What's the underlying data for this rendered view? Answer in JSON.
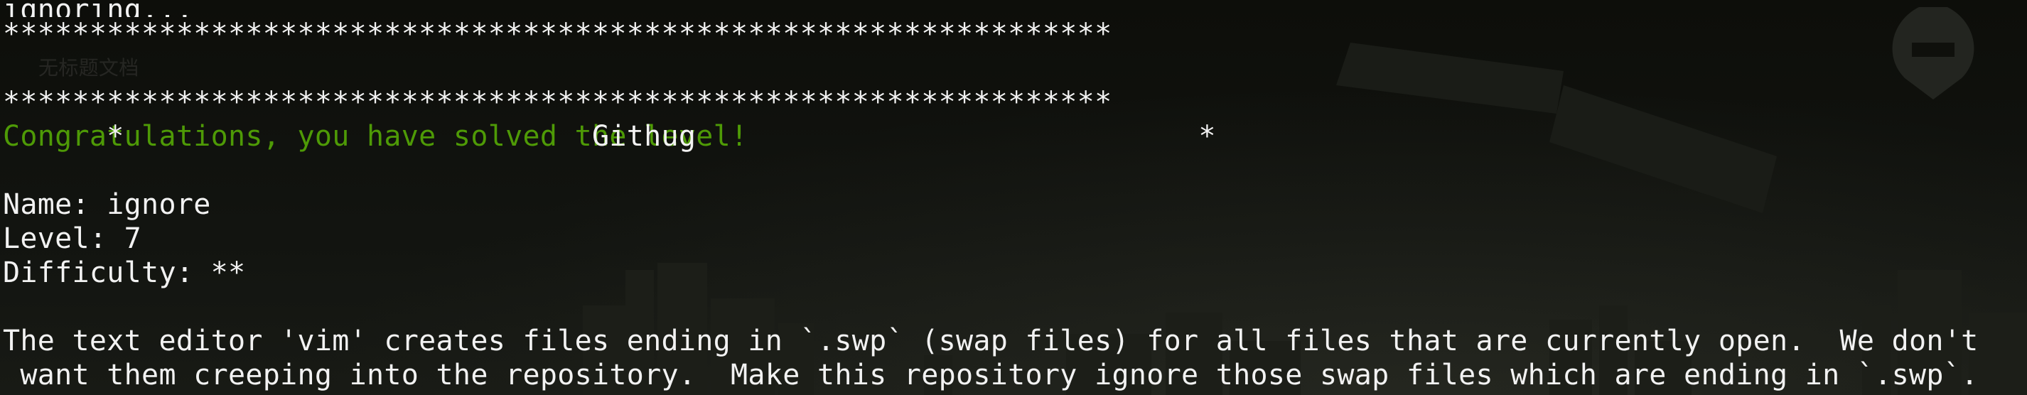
{
  "terminal": {
    "top_partial_line": "ignoring...",
    "banner_stars": "****************************************************************",
    "banner_title_line": "*                           Githug                             *",
    "success_message": "Congratulations, you have solved the level!",
    "level_name_line": "Name: ignore",
    "level_number_line": "Level: 7",
    "difficulty_line": "Difficulty: **",
    "description_line_1": "The text editor 'vim' creates files ending in `.swp` (swap files) for all files that are currently open.  We don't",
    "description_line_2": " want them creeping into the repository.  Make this repository ignore those swap files which are ending in `.swp`."
  },
  "colors": {
    "background": "#0e0f0b",
    "text": "#f2f2f2",
    "success": "#4e9a06"
  }
}
